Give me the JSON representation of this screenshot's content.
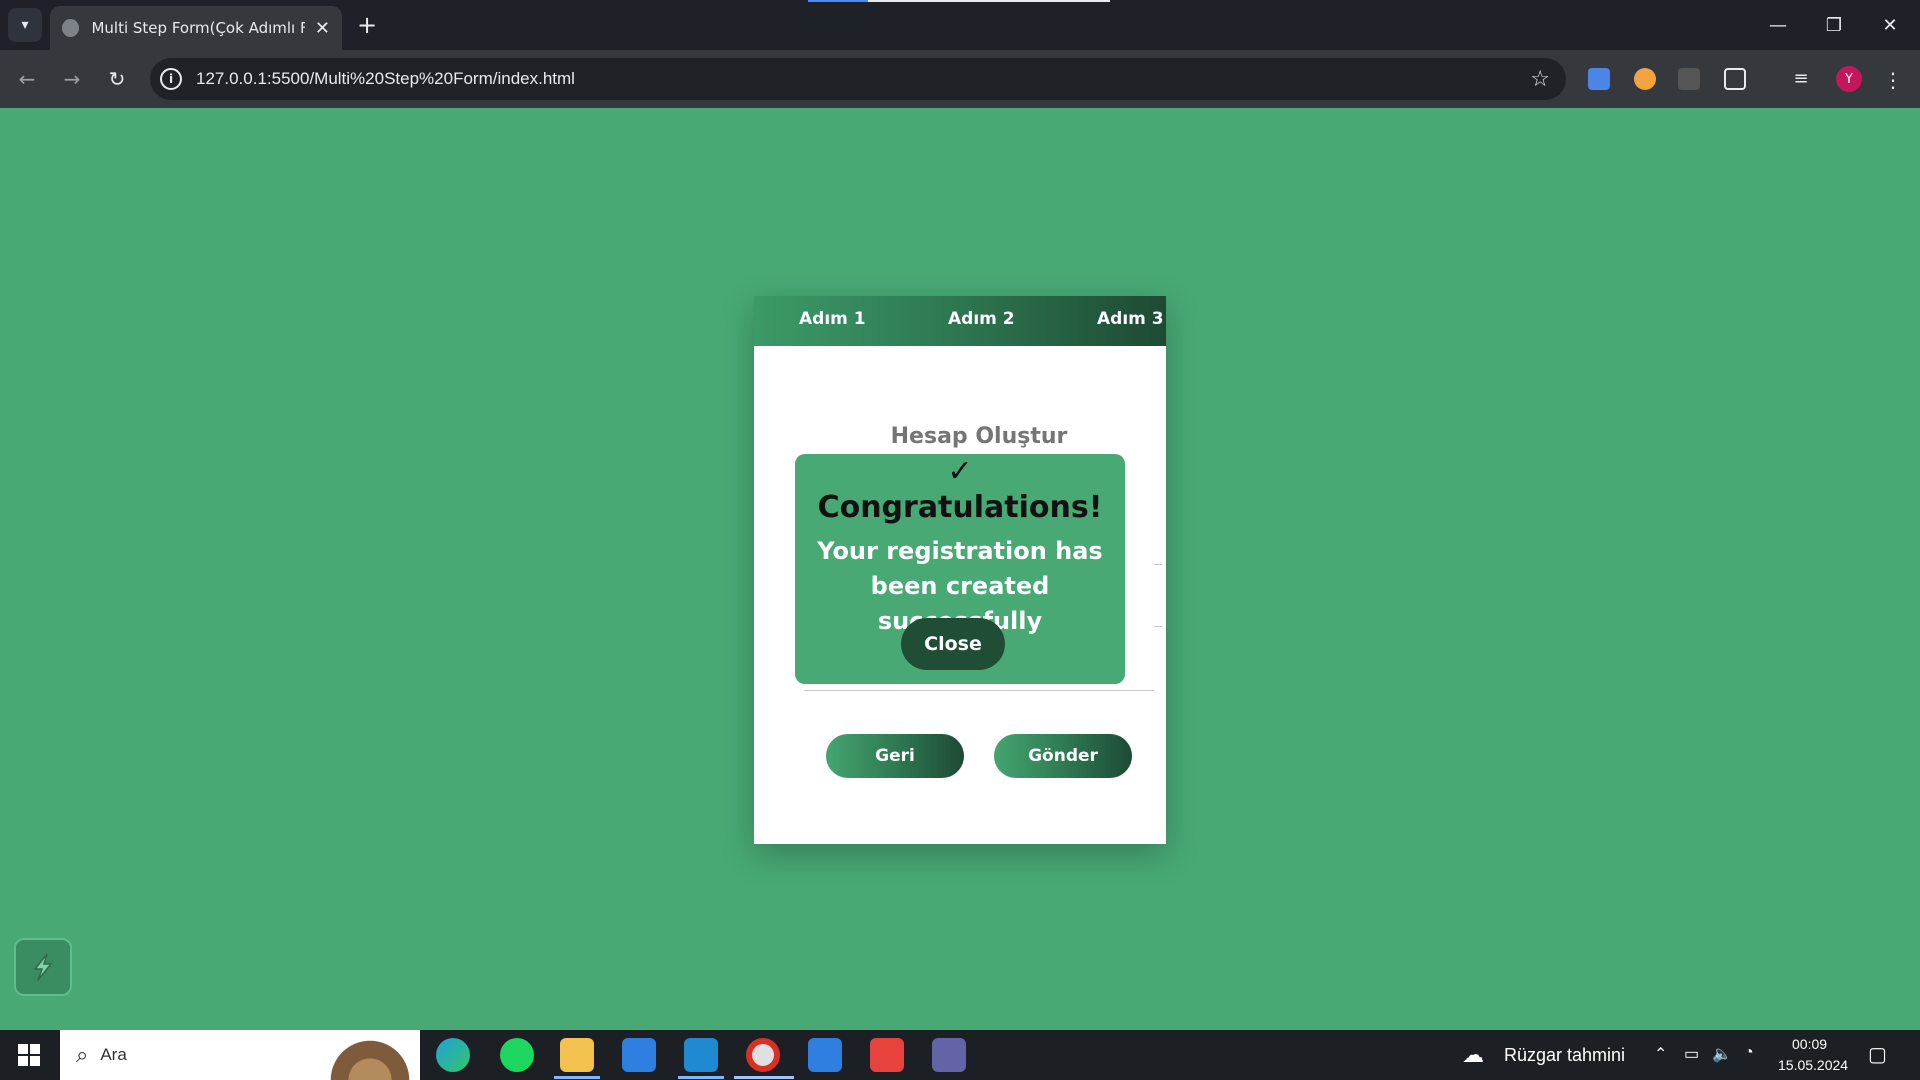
{
  "browser": {
    "tab_title": "Multi Step Form(Çok Adımlı Form)",
    "url": "127.0.0.1:5500/Multi%20Step%20Form/index.html",
    "profile_initial": "Y"
  },
  "form": {
    "steps": [
      "Adım 1",
      "Adım 2",
      "Adım 3"
    ],
    "title": "Hesap Oluştur",
    "back_label": "Geri",
    "submit_label": "Gönder"
  },
  "modal": {
    "check": "✓",
    "title": "Congratulations!",
    "message": "Your registration has been created successfully",
    "close_label": "Close"
  },
  "taskbar": {
    "search_placeholder": "Ara",
    "weather": "Rüzgar tahmini",
    "time": "00:09",
    "date": "15.05.2024"
  },
  "colors": {
    "page_bg": "#48a975",
    "accent_dark": "#1f4d35",
    "modal_bg": "#48a975"
  }
}
